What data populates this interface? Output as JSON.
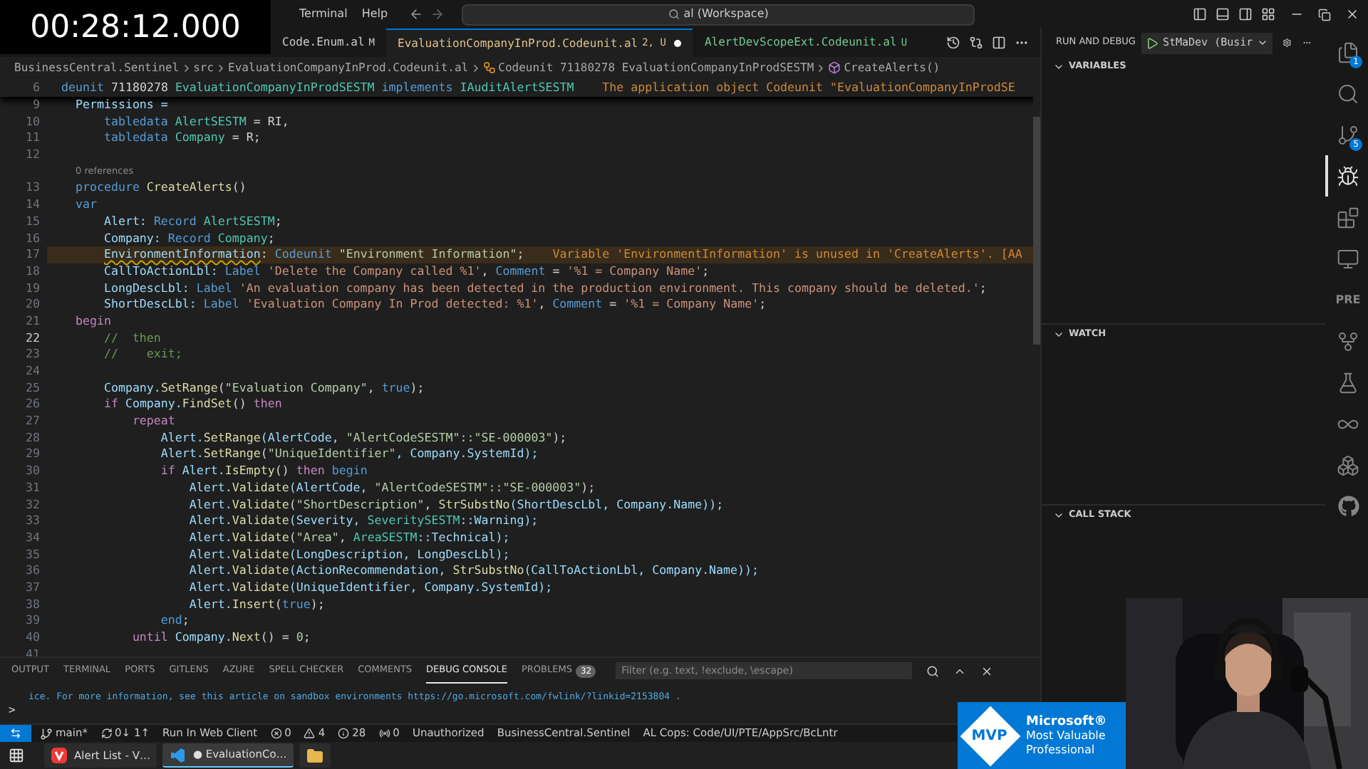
{
  "overlay_timer": "00:28:12.000",
  "title_bar": {
    "menu": [
      "Terminal",
      "Help"
    ],
    "search": "al (Workspace)"
  },
  "tabs": [
    {
      "label": "Code.Enum.al",
      "status": "M",
      "color": "#cccccc",
      "selected": false,
      "dirty": false
    },
    {
      "label": "EvaluationCompanyInProd.Codeunit.al",
      "status": "2, U",
      "color": "#e2c08d",
      "selected": true,
      "dirty": true
    },
    {
      "label": "AlertDevScopeExt.Codeunit.al",
      "status": "U",
      "color": "#73c991",
      "selected": false,
      "dirty": false
    }
  ],
  "breadcrumb": [
    {
      "kind": "folder",
      "text": "BusinessCentral.Sentinel"
    },
    {
      "kind": "folder",
      "text": "src"
    },
    {
      "kind": "file",
      "text": "EvaluationCompanyInProd.Codeunit.al"
    },
    {
      "kind": "codeunit",
      "text": "Codeunit 71180278 EvaluationCompanyInProdSESTM"
    },
    {
      "kind": "method",
      "text": "CreateAlerts()"
    }
  ],
  "sticky_line": {
    "number": "6",
    "tokens": [
      {
        "kind": "kw",
        "text": "deunit"
      },
      {
        "kind": "plain",
        "text": " 71180278 "
      },
      {
        "kind": "type",
        "text": "EvaluationCompanyInProdSESTM"
      },
      {
        "kind": "kw",
        "text": " implements "
      },
      {
        "kind": "type",
        "text": "IAuditAlertSESTM"
      },
      {
        "kind": "warn",
        "text": "    The application object Codeunit \"EvaluationCompanyInProdSE"
      }
    ]
  },
  "editor_lines": [
    {
      "kind": "code",
      "number": "9",
      "tokens": [
        {
          "kind": "ident",
          "text": "    Permissions ="
        }
      ]
    },
    {
      "kind": "code",
      "number": "10",
      "tokens": [
        {
          "kind": "kw",
          "text": "        tabledata"
        },
        {
          "kind": "type",
          "text": " AlertSESTM"
        },
        {
          "kind": "plain",
          "text": " = RI,"
        }
      ]
    },
    {
      "kind": "code",
      "number": "11",
      "tokens": [
        {
          "kind": "kw",
          "text": "        tabledata"
        },
        {
          "kind": "type",
          "text": " Company"
        },
        {
          "kind": "plain",
          "text": " = R;"
        }
      ]
    },
    {
      "kind": "code",
      "number": "12"
    },
    {
      "kind": "codelens",
      "text": "0 references"
    },
    {
      "kind": "code",
      "number": "13",
      "tokens": [
        {
          "kind": "kw",
          "text": "    procedure"
        },
        {
          "kind": "func",
          "text": " CreateAlerts"
        },
        {
          "kind": "plain",
          "text": "()"
        }
      ]
    },
    {
      "kind": "code",
      "number": "14",
      "tokens": [
        {
          "kind": "kw",
          "text": "    var"
        }
      ]
    },
    {
      "kind": "code",
      "number": "15",
      "tokens": [
        {
          "kind": "ident",
          "text": "        Alert: "
        },
        {
          "kind": "kw",
          "text": "Record"
        },
        {
          "kind": "type",
          "text": " AlertSESTM"
        },
        {
          "kind": "plain",
          "text": ";"
        }
      ]
    },
    {
      "kind": "code",
      "number": "16",
      "tokens": [
        {
          "kind": "ident",
          "text": "        Company: "
        },
        {
          "kind": "kw",
          "text": "Record"
        },
        {
          "kind": "type",
          "text": " Company"
        },
        {
          "kind": "plain",
          "text": ";"
        }
      ]
    },
    {
      "kind": "warning",
      "number": "17",
      "tokens": [
        {
          "kind": "ident-warn",
          "text": "        EnvironmentInformation"
        },
        {
          "kind": "plain",
          "text": ": "
        },
        {
          "kind": "kw",
          "text": "Codeunit"
        },
        {
          "kind": "quoted",
          "text": " \"Environment Information\""
        },
        {
          "kind": "plain",
          "text": ";"
        },
        {
          "kind": "warn",
          "text": "    Variable 'EnvironmentInformation' is unused in 'CreateAlerts'. [AA"
        }
      ]
    },
    {
      "kind": "code",
      "number": "18",
      "tokens": [
        {
          "kind": "ident",
          "text": "        CallToActionLbl: "
        },
        {
          "kind": "kw",
          "text": "Label"
        },
        {
          "kind": "string",
          "text": " 'Delete the Company called %1'"
        },
        {
          "kind": "plain",
          "text": ", "
        },
        {
          "kind": "kw",
          "text": "Comment"
        },
        {
          "kind": "plain",
          "text": " = "
        },
        {
          "kind": "string",
          "text": "'%1 = Company Name'"
        },
        {
          "kind": "plain",
          "text": ";"
        }
      ]
    },
    {
      "kind": "code",
      "number": "19",
      "tokens": [
        {
          "kind": "ident",
          "text": "        LongDescLbl: "
        },
        {
          "kind": "kw",
          "text": "Label"
        },
        {
          "kind": "string",
          "text": " 'An evaluation company has been detected in the production environment. This company should be deleted.'"
        },
        {
          "kind": "plain",
          "text": ";"
        }
      ]
    },
    {
      "kind": "code",
      "number": "20",
      "tokens": [
        {
          "kind": "ident",
          "text": "        ShortDescLbl: "
        },
        {
          "kind": "kw",
          "text": "Label"
        },
        {
          "kind": "string",
          "text": " 'Evaluation Company In Prod detected: %1'"
        },
        {
          "kind": "plain",
          "text": ", "
        },
        {
          "kind": "kw",
          "text": "Comment"
        },
        {
          "kind": "plain",
          "text": " = "
        },
        {
          "kind": "string",
          "text": "'%1 = Company Name'"
        },
        {
          "kind": "plain",
          "text": ";"
        }
      ]
    },
    {
      "kind": "code",
      "number": "21",
      "tokens": [
        {
          "kind": "control",
          "text": "    begin"
        }
      ]
    },
    {
      "kind": "current",
      "number": "22",
      "tokens": [
        {
          "kind": "comment",
          "text": "        //  then"
        }
      ]
    },
    {
      "kind": "code",
      "number": "23",
      "tokens": [
        {
          "kind": "comment",
          "text": "        //    exit;"
        }
      ]
    },
    {
      "kind": "code",
      "number": "24"
    },
    {
      "kind": "code",
      "number": "25",
      "tokens": [
        {
          "kind": "ident",
          "text": "        Company."
        },
        {
          "kind": "func",
          "text": "SetRange"
        },
        {
          "kind": "plain",
          "text": "("
        },
        {
          "kind": "quoted",
          "text": "\"Evaluation Company\""
        },
        {
          "kind": "plain",
          "text": ", "
        },
        {
          "kind": "kw",
          "text": "true"
        },
        {
          "kind": "plain",
          "text": ");"
        }
      ]
    },
    {
      "kind": "code",
      "number": "26",
      "tokens": [
        {
          "kind": "control",
          "text": "        if"
        },
        {
          "kind": "ident",
          "text": " Company."
        },
        {
          "kind": "func",
          "text": "FindSet"
        },
        {
          "kind": "plain",
          "text": "() "
        },
        {
          "kind": "control",
          "text": "then"
        }
      ]
    },
    {
      "kind": "code",
      "number": "27",
      "tokens": [
        {
          "kind": "control",
          "text": "            repeat"
        }
      ]
    },
    {
      "kind": "code",
      "number": "28",
      "tokens": [
        {
          "kind": "ident",
          "text": "                Alert."
        },
        {
          "kind": "func",
          "text": "SetRange"
        },
        {
          "kind": "ident",
          "text": "(AlertCode, "
        },
        {
          "kind": "quoted",
          "text": "\"AlertCodeSESTM\"::\"SE-000003\""
        },
        {
          "kind": "plain",
          "text": ");"
        }
      ]
    },
    {
      "kind": "code",
      "number": "29",
      "tokens": [
        {
          "kind": "ident",
          "text": "                Alert."
        },
        {
          "kind": "func",
          "text": "SetRange"
        },
        {
          "kind": "plain",
          "text": "("
        },
        {
          "kind": "quoted",
          "text": "\"UniqueIdentifier\""
        },
        {
          "kind": "ident",
          "text": ", Company.SystemId);"
        }
      ]
    },
    {
      "kind": "code",
      "number": "30",
      "tokens": [
        {
          "kind": "control",
          "text": "                if"
        },
        {
          "kind": "ident",
          "text": " Alert."
        },
        {
          "kind": "func",
          "text": "IsEmpty"
        },
        {
          "kind": "plain",
          "text": "() "
        },
        {
          "kind": "control",
          "text": "then"
        },
        {
          "kind": "kw",
          "text": " begin"
        }
      ]
    },
    {
      "kind": "code",
      "number": "31",
      "tokens": [
        {
          "kind": "ident",
          "text": "                    Alert."
        },
        {
          "kind": "func",
          "text": "Validate"
        },
        {
          "kind": "ident",
          "text": "(AlertCode, "
        },
        {
          "kind": "quoted",
          "text": "\"AlertCodeSESTM\"::\"SE-000003\""
        },
        {
          "kind": "plain",
          "text": ");"
        }
      ]
    },
    {
      "kind": "code",
      "number": "32",
      "tokens": [
        {
          "kind": "ident",
          "text": "                    Alert."
        },
        {
          "kind": "func",
          "text": "Validate"
        },
        {
          "kind": "plain",
          "text": "("
        },
        {
          "kind": "quoted",
          "text": "\"ShortDescription\""
        },
        {
          "kind": "plain",
          "text": ", "
        },
        {
          "kind": "func",
          "text": "StrSubstNo"
        },
        {
          "kind": "ident",
          "text": "(ShortDescLbl, Company.Name));"
        }
      ]
    },
    {
      "kind": "code",
      "number": "33",
      "tokens": [
        {
          "kind": "ident",
          "text": "                    Alert."
        },
        {
          "kind": "func",
          "text": "Validate"
        },
        {
          "kind": "ident",
          "text": "(Severity, "
        },
        {
          "kind": "type",
          "text": "SeveritySESTM"
        },
        {
          "kind": "ident",
          "text": "::Warning);"
        }
      ]
    },
    {
      "kind": "code",
      "number": "34",
      "tokens": [
        {
          "kind": "ident",
          "text": "                    Alert."
        },
        {
          "kind": "func",
          "text": "Validate"
        },
        {
          "kind": "plain",
          "text": "("
        },
        {
          "kind": "quoted",
          "text": "\"Area\""
        },
        {
          "kind": "plain",
          "text": ", "
        },
        {
          "kind": "type",
          "text": "AreaSESTM"
        },
        {
          "kind": "ident",
          "text": "::Technical);"
        }
      ]
    },
    {
      "kind": "code",
      "number": "35",
      "tokens": [
        {
          "kind": "ident",
          "text": "                    Alert."
        },
        {
          "kind": "func",
          "text": "Validate"
        },
        {
          "kind": "ident",
          "text": "(LongDescription, LongDescLbl);"
        }
      ]
    },
    {
      "kind": "code",
      "number": "36",
      "tokens": [
        {
          "kind": "ident",
          "text": "                    Alert."
        },
        {
          "kind": "func",
          "text": "Validate"
        },
        {
          "kind": "ident",
          "text": "(ActionRecommendation, "
        },
        {
          "kind": "func",
          "text": "StrSubstNo"
        },
        {
          "kind": "ident",
          "text": "(CallToActionLbl, Company.Name));"
        }
      ]
    },
    {
      "kind": "code",
      "number": "37",
      "tokens": [
        {
          "kind": "ident",
          "text": "                    Alert."
        },
        {
          "kind": "func",
          "text": "Validate"
        },
        {
          "kind": "ident",
          "text": "(UniqueIdentifier, Company.SystemId);"
        }
      ]
    },
    {
      "kind": "code",
      "number": "38",
      "tokens": [
        {
          "kind": "ident",
          "text": "                    Alert."
        },
        {
          "kind": "func",
          "text": "Insert"
        },
        {
          "kind": "plain",
          "text": "("
        },
        {
          "kind": "kw",
          "text": "true"
        },
        {
          "kind": "plain",
          "text": ");"
        }
      ]
    },
    {
      "kind": "code",
      "number": "39",
      "tokens": [
        {
          "kind": "kw",
          "text": "                end"
        },
        {
          "kind": "plain",
          "text": ";"
        }
      ]
    },
    {
      "kind": "code",
      "number": "40",
      "tokens": [
        {
          "kind": "control",
          "text": "            until"
        },
        {
          "kind": "ident",
          "text": " Company."
        },
        {
          "kind": "func",
          "text": "Next"
        },
        {
          "kind": "plain",
          "text": "() = "
        },
        {
          "kind": "number",
          "text": "0"
        },
        {
          "kind": "plain",
          "text": ";"
        }
      ]
    },
    {
      "kind": "code",
      "number": "41"
    }
  ],
  "run_and_debug": {
    "title": "RUN AND DEBUG",
    "configuration": "StMaDev (Busir"
  },
  "debug_sections": [
    {
      "title": "VARIABLES",
      "expanded": true
    },
    {
      "title": "WATCH",
      "expanded": true
    },
    {
      "title": "CALL STACK",
      "expanded": true
    }
  ],
  "activity_bar": [
    {
      "kind": "explorer",
      "selected": false,
      "badge": "1"
    },
    {
      "kind": "search",
      "selected": false
    },
    {
      "kind": "source-control",
      "selected": false,
      "badge": "5"
    },
    {
      "kind": "run-debug",
      "selected": true
    },
    {
      "kind": "extensions",
      "selected": false
    },
    {
      "kind": "remote",
      "selected": false
    },
    {
      "kind": "text",
      "label": "PRE",
      "selected": false
    },
    {
      "kind": "graph",
      "selected": false
    },
    {
      "kind": "testing",
      "selected": false
    },
    {
      "kind": "infinity",
      "selected": false
    },
    {
      "kind": "boxes",
      "selected": false
    },
    {
      "kind": "github",
      "selected": false
    }
  ],
  "panel_tabs": [
    {
      "label": "OUTPUT",
      "selected": false
    },
    {
      "label": "TERMINAL",
      "selected": false
    },
    {
      "label": "PORTS",
      "selected": false
    },
    {
      "label": "GITLENS",
      "selected": false
    },
    {
      "label": "AZURE",
      "selected": false
    },
    {
      "label": "SPELL CHECKER",
      "selected": false
    },
    {
      "label": "COMMENTS",
      "selected": false
    },
    {
      "label": "DEBUG CONSOLE",
      "selected": true
    },
    {
      "label": "PROBLEMS",
      "selected": false,
      "badge": "32"
    }
  ],
  "panel_filter": {
    "placeholder": "Filter (e.g. text, !exclude, \\escape)"
  },
  "console": {
    "lines": [
      "ice. For more information, see this article on sandbox environments https://go.microsoft.com/fwlink/?linkid=2153804 ."
    ],
    "prompt": ">"
  },
  "status_bar": [
    {
      "kind": "branch",
      "text": "main*"
    },
    {
      "kind": "sync",
      "text": "0↓ 1↑"
    },
    {
      "kind": "text",
      "text": "Run In Web Client"
    },
    {
      "kind": "errors",
      "text": "0"
    },
    {
      "kind": "warnings",
      "text": "4"
    },
    {
      "kind": "info",
      "text": "28"
    },
    {
      "kind": "ports",
      "text": "0"
    },
    {
      "kind": "text",
      "text": "Unauthorized"
    },
    {
      "kind": "text",
      "text": "BusinessCentral.Sentinel"
    },
    {
      "kind": "text",
      "text": "AL Cops: Code/UI/PTE/AppSrc/BcLntr"
    }
  ],
  "taskbar": [
    {
      "kind": "vivaldi",
      "label": "Alert List - V…",
      "selected": false
    },
    {
      "kind": "vscode",
      "label": "● EvaluationCo…",
      "selected": true
    },
    {
      "kind": "folder",
      "selected": false
    }
  ],
  "mvp_badge": {
    "mark": "MVP",
    "lines": [
      "Microsoft®",
      "Most Valuable",
      "Professional"
    ]
  }
}
